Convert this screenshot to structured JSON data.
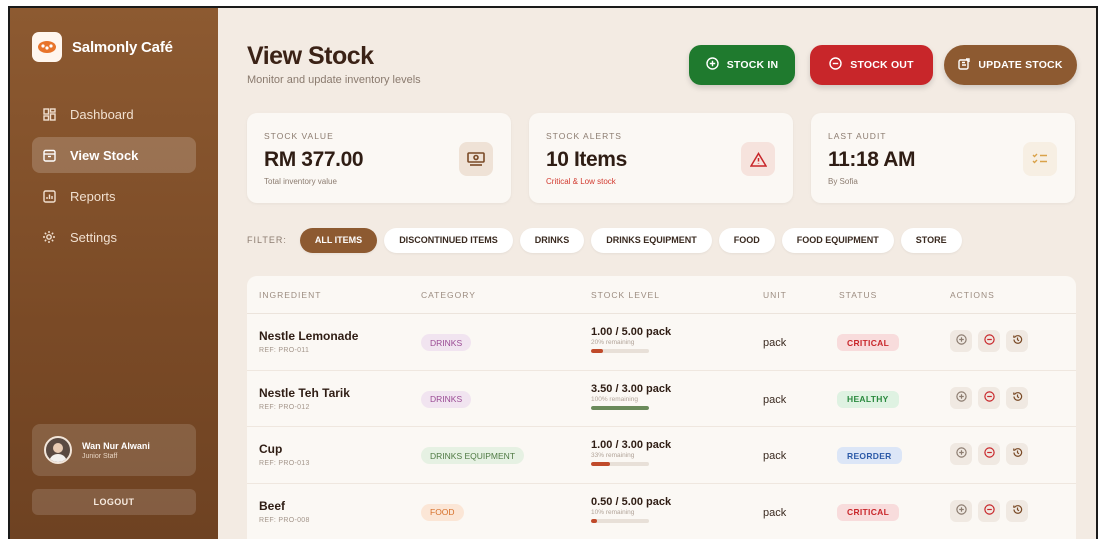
{
  "app": {
    "brand_name": "Salmonly Café",
    "colors": {
      "brand": "#8d5a31",
      "stock_in": "#1f7a2e",
      "stock_out": "#c8262a",
      "background": "#f3ebe3"
    }
  },
  "sidebar": {
    "items": [
      {
        "label": "Dashboard",
        "icon": "dashboard-icon",
        "active": false
      },
      {
        "label": "View Stock",
        "icon": "box-icon",
        "active": true
      },
      {
        "label": "Reports",
        "icon": "chart-icon",
        "active": false
      },
      {
        "label": "Settings",
        "icon": "gear-icon",
        "active": false
      }
    ],
    "user": {
      "name": "Wan Nur Alwani",
      "role": "Junior Staff"
    },
    "logout_label": "LOGOUT"
  },
  "header": {
    "title": "View Stock",
    "subtitle": "Monitor and update inventory levels",
    "stock_in_label": "STOCK IN",
    "stock_out_label": "STOCK OUT",
    "update_stock_label": "UPDATE STOCK"
  },
  "cards": [
    {
      "label": "STOCK VALUE",
      "value": "RM 377.00",
      "sub": "Total inventory value",
      "icon": "money-icon"
    },
    {
      "label": "STOCK ALERTS",
      "value": "10 Items",
      "sub": "Critical & Low stock",
      "icon": "warning-icon"
    },
    {
      "label": "LAST AUDIT",
      "value": "11:18 AM",
      "sub": "By Sofia",
      "icon": "checklist-icon"
    }
  ],
  "filter": {
    "label": "FILTER:",
    "chips": [
      "ALL ITEMS",
      "DISCONTINUED ITEMS",
      "DRINKS",
      "DRINKS EQUIPMENT",
      "FOOD",
      "FOOD EQUIPMENT",
      "STORE"
    ],
    "active": "ALL ITEMS"
  },
  "table": {
    "headers": [
      "INGREDIENT",
      "CATEGORY",
      "STOCK LEVEL",
      "UNIT",
      "STATUS",
      "ACTIONS"
    ],
    "rows": [
      {
        "name": "Nestle Lemonade",
        "ref": "REF: PRO-011",
        "category": "DRINKS",
        "level": "1.00 / 5.00 pack",
        "remaining": "20% remaining",
        "fill": 0.2,
        "fill_color": "#c04a2a",
        "unit": "pack",
        "status": "CRITICAL"
      },
      {
        "name": "Nestle Teh Tarik",
        "ref": "REF: PRO-012",
        "category": "DRINKS",
        "level": "3.50 / 3.00 pack",
        "remaining": "100% remaining",
        "fill": 1.0,
        "fill_color": "#6a8a5a",
        "unit": "pack",
        "status": "HEALTHY"
      },
      {
        "name": "Cup",
        "ref": "REF: PRO-013",
        "category": "DRINKS EQUIPMENT",
        "level": "1.00 / 3.00 pack",
        "remaining": "33% remaining",
        "fill": 0.33,
        "fill_color": "#c04a2a",
        "unit": "pack",
        "status": "REORDER"
      },
      {
        "name": "Beef",
        "ref": "REF: PRO-008",
        "category": "FOOD",
        "level": "0.50 / 5.00 pack",
        "remaining": "10% remaining",
        "fill": 0.1,
        "fill_color": "#c04a2a",
        "unit": "pack",
        "status": "CRITICAL"
      }
    ]
  }
}
